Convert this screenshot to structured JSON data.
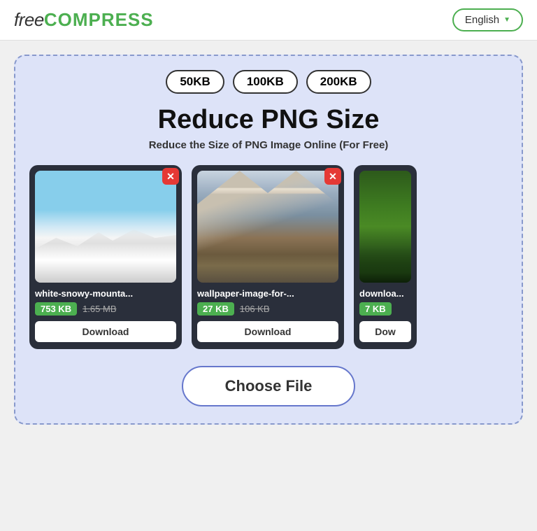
{
  "header": {
    "logo_free": "free",
    "logo_compress": "COMPRESS",
    "lang_label": "English",
    "lang_chevron": "▼"
  },
  "size_badges": [
    "50KB",
    "100KB",
    "200KB"
  ],
  "page": {
    "title": "Reduce PNG Size",
    "subtitle": "Reduce the Size of PNG Image Online (For Free)"
  },
  "images": [
    {
      "filename": "white-snowy-mounta...",
      "size_compressed": "753 KB",
      "size_original": "1.65 MB",
      "download_label": "Download",
      "type": "snow"
    },
    {
      "filename": "wallpaper-image-for-...",
      "size_compressed": "27 KB",
      "size_original": "106 KB",
      "download_label": "Download",
      "type": "mountain"
    },
    {
      "filename": "downloa...",
      "size_compressed": "7 KB",
      "size_original": "...",
      "download_label": "Dow",
      "type": "forest"
    }
  ],
  "choose_file": {
    "label": "Choose File"
  }
}
